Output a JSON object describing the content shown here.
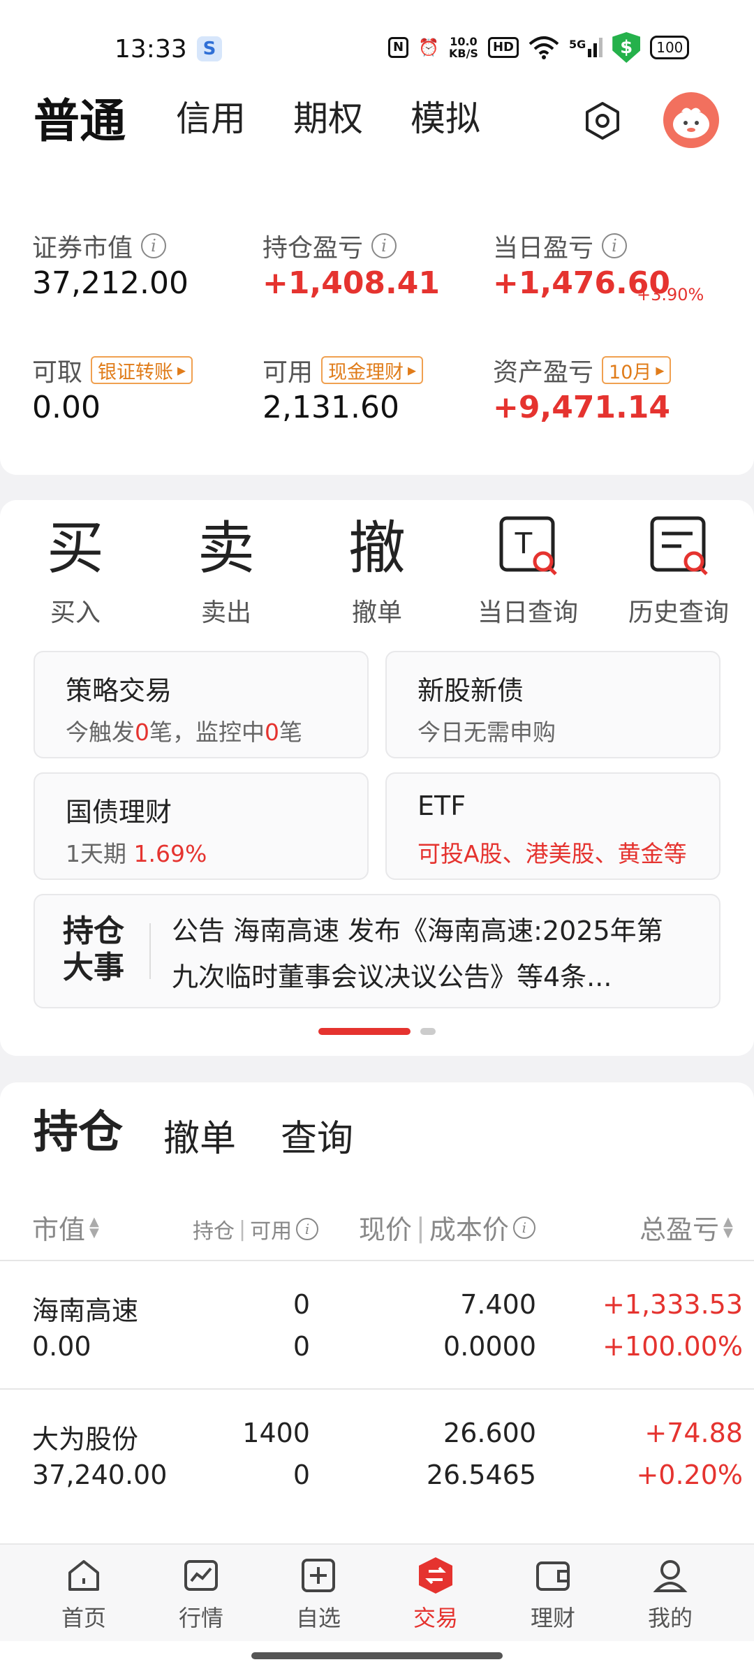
{
  "status_bar": {
    "time": "13:33",
    "app_badge": "S",
    "nfc": "N",
    "net_speed_value": "10.0",
    "net_speed_unit": "KB/S",
    "hd": "HD",
    "signal": "5G",
    "battery": "100"
  },
  "top_tabs": [
    "普通",
    "信用",
    "期权",
    "模拟"
  ],
  "assets": {
    "market_value_label": "证券市值",
    "market_value": "37,212.00",
    "position_pl_label": "持仓盈亏",
    "position_pl": "+1,408.41",
    "day_pl_label": "当日盈亏",
    "day_pl": "+1,476.60",
    "day_pl_pct": "+3.90%",
    "withdrawable_label": "可取",
    "withdrawable": "0.00",
    "transfer_btn": "银证转账",
    "available_label": "可用",
    "available": "2,131.60",
    "cash_mgmt_btn": "现金理财",
    "asset_pl_label": "资产盈亏",
    "asset_pl_month_btn": "10月",
    "asset_pl": "+9,471.14"
  },
  "functions": [
    {
      "glyph": "买",
      "label": "买入"
    },
    {
      "glyph": "卖",
      "label": "卖出"
    },
    {
      "glyph": "撤",
      "label": "撤单"
    },
    {
      "glyph": "T",
      "label": "当日查询"
    },
    {
      "glyph": "≡",
      "label": "历史查询"
    }
  ],
  "cards": {
    "strategy_title": "策略交易",
    "strategy_sub_a": "今触发",
    "strategy_count_a": "0",
    "strategy_sub_b": "笔，监控中",
    "strategy_count_b": "0",
    "strategy_sub_c": "笔",
    "ipo_title": "新股新债",
    "ipo_sub": "今日无需申购",
    "bond_title": "国债理财",
    "bond_sub_a": "1天期",
    "bond_rate": "1.69%",
    "etf_title": "ETF",
    "etf_sub": "可投A股、港美股、黄金等"
  },
  "news": {
    "head": "持仓大事",
    "text": "公告 海南高速 发布《海南高速:2025年第九次临时董事会议决议公告》等4条..."
  },
  "holdings": {
    "tabs": [
      "持仓",
      "撤单",
      "查询"
    ],
    "col_market_value": "市值",
    "col_position": "持仓",
    "col_available": "可用",
    "col_price": "现价",
    "col_cost": "成本价",
    "col_total_pl": "总盈亏",
    "rows": [
      {
        "name": "海南高速",
        "market_value": "0.00",
        "position": "0",
        "available": "0",
        "price": "7.400",
        "cost": "0.0000",
        "pl": "+1,333.53",
        "pl_pct": "+100.00%"
      },
      {
        "name": "大为股份",
        "market_value": "37,240.00",
        "position": "1400",
        "available": "0",
        "price": "26.600",
        "cost": "26.5465",
        "pl": "+74.88",
        "pl_pct": "+0.20%"
      }
    ]
  },
  "bottom_nav": [
    "首页",
    "行情",
    "自选",
    "交易",
    "理财",
    "我的"
  ],
  "colors": {
    "accent_red": "#e5332f",
    "tag_orange": "#e07c1a"
  }
}
